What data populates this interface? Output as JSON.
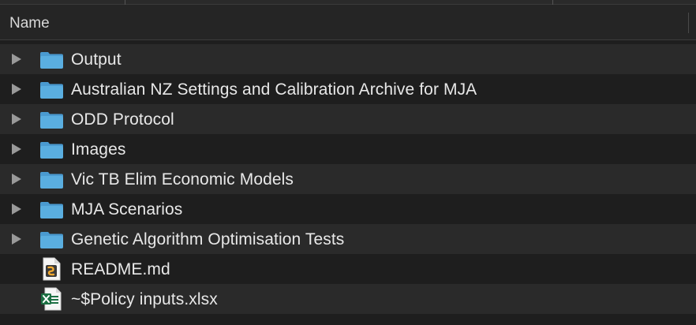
{
  "header": {
    "name_column": "Name"
  },
  "rows": [
    {
      "label": "Output",
      "kind": "folder",
      "icon": "folder-icon"
    },
    {
      "label": "Australian NZ Settings and Calibration Archive for MJA",
      "kind": "folder",
      "icon": "folder-icon"
    },
    {
      "label": "ODD Protocol",
      "kind": "folder",
      "icon": "folder-icon"
    },
    {
      "label": "Images",
      "kind": "folder",
      "icon": "folder-icon"
    },
    {
      "label": "Vic TB Elim Economic Models",
      "kind": "folder",
      "icon": "folder-icon"
    },
    {
      "label": "MJA Scenarios",
      "kind": "folder",
      "icon": "folder-icon"
    },
    {
      "label": "Genetic Algorithm Optimisation Tests",
      "kind": "folder",
      "icon": "folder-icon"
    },
    {
      "label": "README.md",
      "kind": "file",
      "icon": "markdown-file-icon"
    },
    {
      "label": "~$Policy inputs.xlsx",
      "kind": "file",
      "icon": "excel-file-icon"
    }
  ],
  "colors": {
    "background": "#1e1e1e",
    "row_alternate": "#2a2a2a",
    "folder_blue": "#5aaee0",
    "text": "#e8e8e8",
    "excel_green": "#1d7044",
    "markdown_orange": "#f0a830"
  }
}
